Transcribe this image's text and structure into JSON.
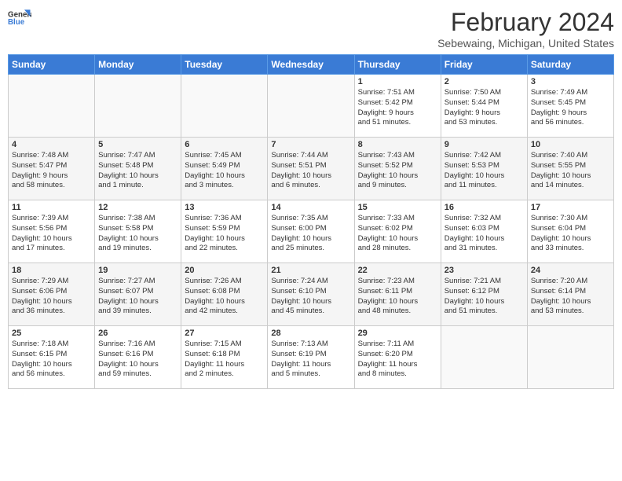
{
  "logo": {
    "line1": "General",
    "line2": "Blue"
  },
  "title": "February 2024",
  "location": "Sebewaing, Michigan, United States",
  "days_of_week": [
    "Sunday",
    "Monday",
    "Tuesday",
    "Wednesday",
    "Thursday",
    "Friday",
    "Saturday"
  ],
  "weeks": [
    [
      {
        "day": "",
        "info": ""
      },
      {
        "day": "",
        "info": ""
      },
      {
        "day": "",
        "info": ""
      },
      {
        "day": "",
        "info": ""
      },
      {
        "day": "1",
        "info": "Sunrise: 7:51 AM\nSunset: 5:42 PM\nDaylight: 9 hours\nand 51 minutes."
      },
      {
        "day": "2",
        "info": "Sunrise: 7:50 AM\nSunset: 5:44 PM\nDaylight: 9 hours\nand 53 minutes."
      },
      {
        "day": "3",
        "info": "Sunrise: 7:49 AM\nSunset: 5:45 PM\nDaylight: 9 hours\nand 56 minutes."
      }
    ],
    [
      {
        "day": "4",
        "info": "Sunrise: 7:48 AM\nSunset: 5:47 PM\nDaylight: 9 hours\nand 58 minutes."
      },
      {
        "day": "5",
        "info": "Sunrise: 7:47 AM\nSunset: 5:48 PM\nDaylight: 10 hours\nand 1 minute."
      },
      {
        "day": "6",
        "info": "Sunrise: 7:45 AM\nSunset: 5:49 PM\nDaylight: 10 hours\nand 3 minutes."
      },
      {
        "day": "7",
        "info": "Sunrise: 7:44 AM\nSunset: 5:51 PM\nDaylight: 10 hours\nand 6 minutes."
      },
      {
        "day": "8",
        "info": "Sunrise: 7:43 AM\nSunset: 5:52 PM\nDaylight: 10 hours\nand 9 minutes."
      },
      {
        "day": "9",
        "info": "Sunrise: 7:42 AM\nSunset: 5:53 PM\nDaylight: 10 hours\nand 11 minutes."
      },
      {
        "day": "10",
        "info": "Sunrise: 7:40 AM\nSunset: 5:55 PM\nDaylight: 10 hours\nand 14 minutes."
      }
    ],
    [
      {
        "day": "11",
        "info": "Sunrise: 7:39 AM\nSunset: 5:56 PM\nDaylight: 10 hours\nand 17 minutes."
      },
      {
        "day": "12",
        "info": "Sunrise: 7:38 AM\nSunset: 5:58 PM\nDaylight: 10 hours\nand 19 minutes."
      },
      {
        "day": "13",
        "info": "Sunrise: 7:36 AM\nSunset: 5:59 PM\nDaylight: 10 hours\nand 22 minutes."
      },
      {
        "day": "14",
        "info": "Sunrise: 7:35 AM\nSunset: 6:00 PM\nDaylight: 10 hours\nand 25 minutes."
      },
      {
        "day": "15",
        "info": "Sunrise: 7:33 AM\nSunset: 6:02 PM\nDaylight: 10 hours\nand 28 minutes."
      },
      {
        "day": "16",
        "info": "Sunrise: 7:32 AM\nSunset: 6:03 PM\nDaylight: 10 hours\nand 31 minutes."
      },
      {
        "day": "17",
        "info": "Sunrise: 7:30 AM\nSunset: 6:04 PM\nDaylight: 10 hours\nand 33 minutes."
      }
    ],
    [
      {
        "day": "18",
        "info": "Sunrise: 7:29 AM\nSunset: 6:06 PM\nDaylight: 10 hours\nand 36 minutes."
      },
      {
        "day": "19",
        "info": "Sunrise: 7:27 AM\nSunset: 6:07 PM\nDaylight: 10 hours\nand 39 minutes."
      },
      {
        "day": "20",
        "info": "Sunrise: 7:26 AM\nSunset: 6:08 PM\nDaylight: 10 hours\nand 42 minutes."
      },
      {
        "day": "21",
        "info": "Sunrise: 7:24 AM\nSunset: 6:10 PM\nDaylight: 10 hours\nand 45 minutes."
      },
      {
        "day": "22",
        "info": "Sunrise: 7:23 AM\nSunset: 6:11 PM\nDaylight: 10 hours\nand 48 minutes."
      },
      {
        "day": "23",
        "info": "Sunrise: 7:21 AM\nSunset: 6:12 PM\nDaylight: 10 hours\nand 51 minutes."
      },
      {
        "day": "24",
        "info": "Sunrise: 7:20 AM\nSunset: 6:14 PM\nDaylight: 10 hours\nand 53 minutes."
      }
    ],
    [
      {
        "day": "25",
        "info": "Sunrise: 7:18 AM\nSunset: 6:15 PM\nDaylight: 10 hours\nand 56 minutes."
      },
      {
        "day": "26",
        "info": "Sunrise: 7:16 AM\nSunset: 6:16 PM\nDaylight: 10 hours\nand 59 minutes."
      },
      {
        "day": "27",
        "info": "Sunrise: 7:15 AM\nSunset: 6:18 PM\nDaylight: 11 hours\nand 2 minutes."
      },
      {
        "day": "28",
        "info": "Sunrise: 7:13 AM\nSunset: 6:19 PM\nDaylight: 11 hours\nand 5 minutes."
      },
      {
        "day": "29",
        "info": "Sunrise: 7:11 AM\nSunset: 6:20 PM\nDaylight: 11 hours\nand 8 minutes."
      },
      {
        "day": "",
        "info": ""
      },
      {
        "day": "",
        "info": ""
      }
    ]
  ]
}
